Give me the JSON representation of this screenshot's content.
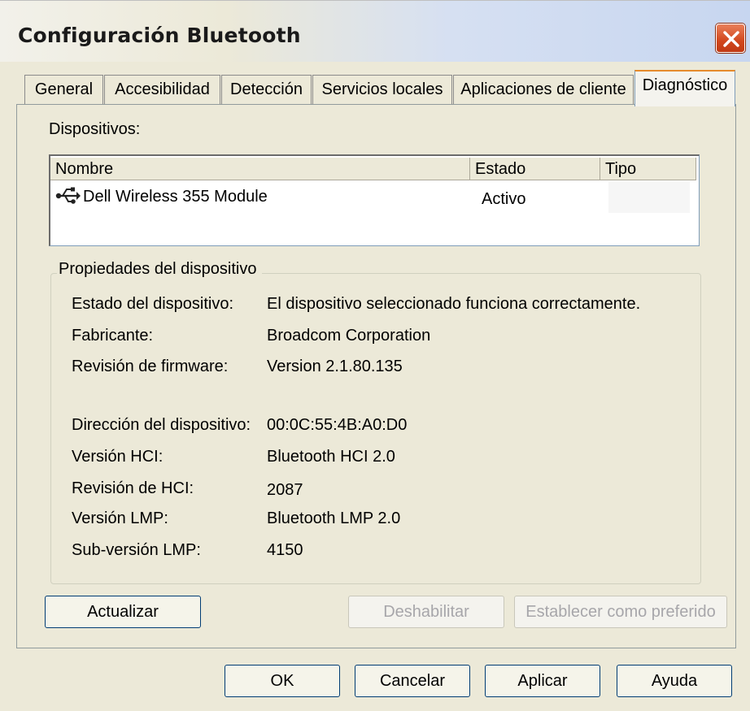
{
  "window": {
    "title": "Configuración Bluetooth"
  },
  "tabs": [
    {
      "label": "General"
    },
    {
      "label": "Accesibilidad"
    },
    {
      "label": "Detección"
    },
    {
      "label": "Servicios locales"
    },
    {
      "label": "Aplicaciones de cliente"
    },
    {
      "label": "Diagnóstico",
      "active": true
    }
  ],
  "devices": {
    "label": "Dispositivos:",
    "columns": [
      "Nombre",
      "Estado",
      "Tipo"
    ],
    "rows": [
      {
        "icon": "usb-icon",
        "name": "Dell Wireless 355 Module",
        "status": "Activo",
        "type": ""
      }
    ]
  },
  "properties": {
    "legend": "Propiedades del dispositivo",
    "items": [
      {
        "label": "Estado del dispositivo:",
        "value": "El dispositivo seleccionado funciona correctamente."
      },
      {
        "label": "Fabricante:",
        "value": "Broadcom Corporation"
      },
      {
        "label": "Revisión de firmware:",
        "value": "Version 2.1.80.135"
      },
      {
        "label": "Dirección del dispositivo:",
        "value": "00:0C:55:4B:A0:D0"
      },
      {
        "label": "Versión HCI:",
        "value": "Bluetooth HCI 2.0"
      },
      {
        "label": "Revisión de HCI:",
        "value": "2087"
      },
      {
        "label": "Versión LMP:",
        "value": "Bluetooth LMP 2.0"
      },
      {
        "label": "Sub-versión LMP:",
        "value": "4150"
      }
    ]
  },
  "actions": {
    "refresh": "Actualizar",
    "disable": "Deshabilitar",
    "set_preferred": "Establecer como preferido"
  },
  "footer": {
    "ok": "OK",
    "cancel": "Cancelar",
    "apply": "Aplicar",
    "help": "Ayuda"
  }
}
